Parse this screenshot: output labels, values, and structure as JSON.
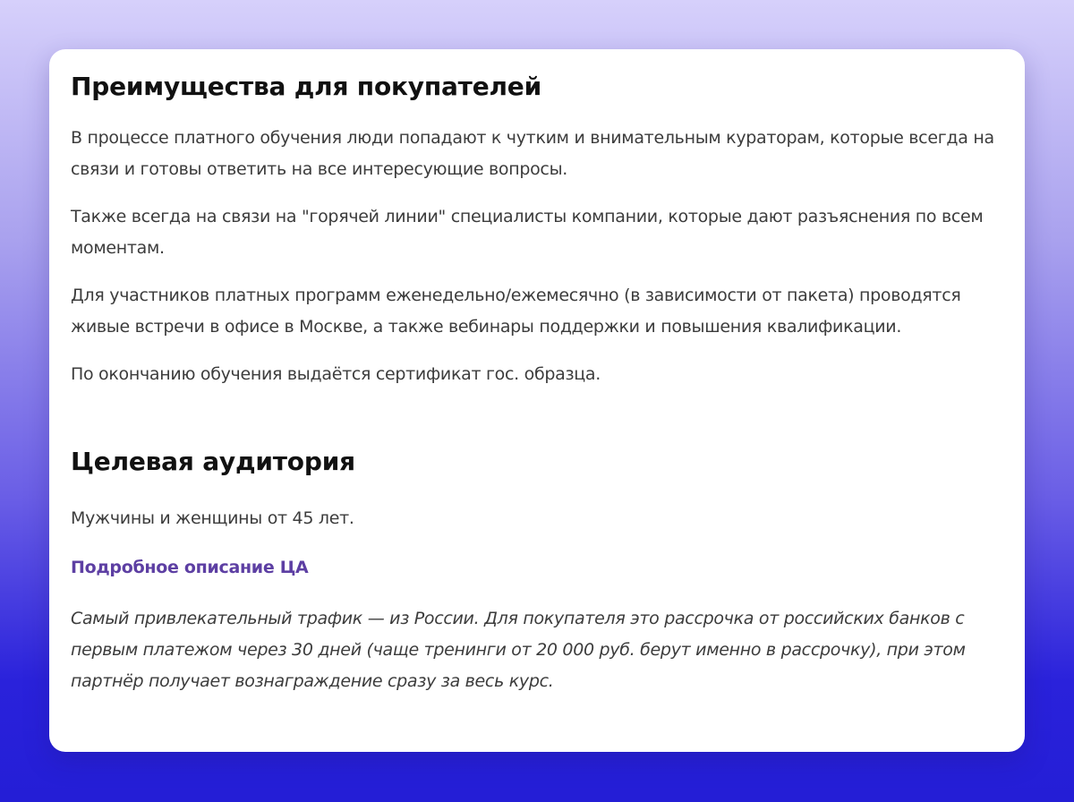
{
  "section1": {
    "heading": "Преимущества для покупателей",
    "paragraphs": [
      "В процессе платного обучения люди попадают к чутким и внимательным кураторам, которые всегда на связи и готовы ответить на все интересующие вопросы.",
      "Также всегда на связи на \"горячей линии\" специалисты компании, которые дают разъяснения по всем моментам.",
      "Для участников платных программ еженедельно/ежемесячно (в зависимости от пакета) проводятся живые встречи в офисе в Москве, а также вебинары поддержки и повышения квалификации.",
      "По окончанию обучения выдаётся сертификат гос. образца."
    ]
  },
  "section2": {
    "heading": "Целевая аудитория",
    "audience_text": "Мужчины и женщины от 45 лет.",
    "link_label": "Подробное описание ЦА",
    "note": "Самый привлекательный трафик — из России. Для покупателя это рассрочка от российских банков с первым платежом через 30 дней (чаще тренинги от 20 000 руб. берут именно в рассрочку), при этом партнёр получает вознаграждение сразу за весь курс."
  },
  "colors": {
    "link": "#5d3fa3",
    "heading": "#111111",
    "body_text": "#3c3c3c"
  }
}
